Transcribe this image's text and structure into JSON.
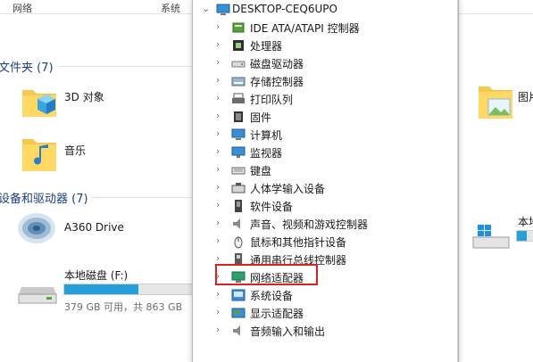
{
  "explorer": {
    "tabs": [
      {
        "label": "网络"
      },
      {
        "label": "系统"
      }
    ],
    "folders_header": "文件夹 (7)",
    "folders": [
      {
        "label": "3D 对象",
        "icon": "3d-objects-icon"
      },
      {
        "label": "音乐",
        "icon": "music-folder-icon"
      },
      {
        "label": "图片",
        "icon": "pictures-folder-icon"
      }
    ],
    "devices_header": "设备和驱动器 (7)",
    "devices": [
      {
        "label": "A360 Drive",
        "icon": "a360-drive-icon"
      },
      {
        "label": "本地磁盘 (F:)",
        "info": "379 GB 可用，共 863 GB",
        "used_fraction": 0.56
      },
      {
        "label": "本地",
        "icon": "windows-drive-icon",
        "used_fraction": 0.3
      }
    ]
  },
  "device_manager": {
    "root": {
      "label": "DESKTOP-CEQ6UPO",
      "icon": "computer-icon"
    },
    "items": [
      {
        "label": "IDE ATA/ATAPI 控制器",
        "icon": "ide-controller-icon"
      },
      {
        "label": "处理器",
        "icon": "processor-icon"
      },
      {
        "label": "磁盘驱动器",
        "icon": "disk-drive-icon"
      },
      {
        "label": "存储控制器",
        "icon": "storage-controller-icon"
      },
      {
        "label": "打印队列",
        "icon": "printer-icon"
      },
      {
        "label": "固件",
        "icon": "firmware-icon"
      },
      {
        "label": "计算机",
        "icon": "computer-icon"
      },
      {
        "label": "监视器",
        "icon": "monitor-icon"
      },
      {
        "label": "键盘",
        "icon": "keyboard-icon"
      },
      {
        "label": "人体学输入设备",
        "icon": "hid-icon"
      },
      {
        "label": "软件设备",
        "icon": "software-device-icon"
      },
      {
        "label": "声音、视频和游戏控制器",
        "icon": "sound-icon"
      },
      {
        "label": "鼠标和其他指针设备",
        "icon": "mouse-icon"
      },
      {
        "label": "通用串行总线控制器",
        "icon": "usb-icon"
      },
      {
        "label": "网络适配器",
        "icon": "network-adapter-icon",
        "highlighted": true
      },
      {
        "label": "系统设备",
        "icon": "system-device-icon"
      },
      {
        "label": "显示适配器",
        "icon": "display-adapter-icon"
      },
      {
        "label": "音频输入和输出",
        "icon": "audio-io-icon"
      }
    ]
  },
  "colors": {
    "accent": "#26a0da",
    "highlight_box": "#e02020",
    "section_header": "#1e3f8a"
  }
}
